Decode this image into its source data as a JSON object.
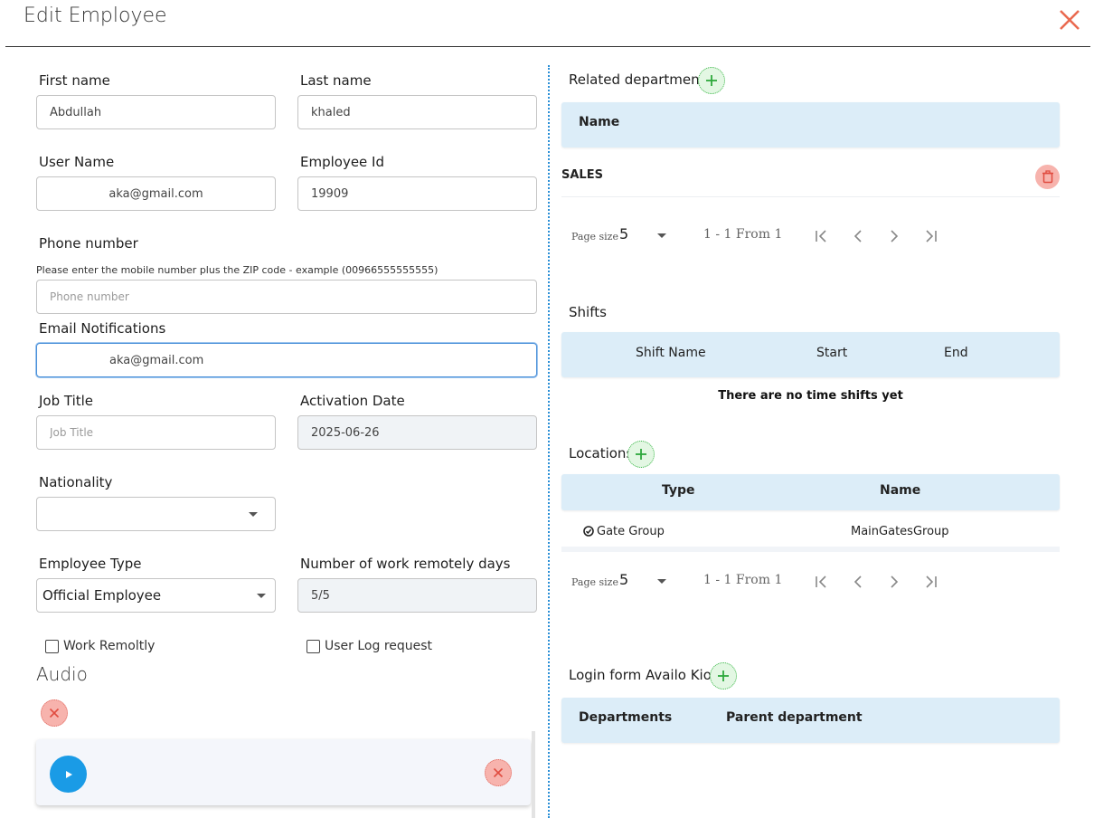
{
  "header": {
    "title": "Edit Employee"
  },
  "form": {
    "first_name": {
      "label": "First name",
      "value": "Abdullah"
    },
    "last_name": {
      "label": "Last name",
      "value": "khaled"
    },
    "user_name": {
      "label": "User Name",
      "value": "aka@gmail.com"
    },
    "employee_id": {
      "label": "Employee Id",
      "value": "19909"
    },
    "phone": {
      "label": "Phone number",
      "hint": "Please enter the mobile number plus the ZIP code - example (00966555555555)",
      "placeholder": "Phone number",
      "value": ""
    },
    "email_notifications": {
      "label": "Email Notifications",
      "value": "aka@gmail.com"
    },
    "job_title": {
      "label": "Job Title",
      "placeholder": "Job Title",
      "value": ""
    },
    "activation_date": {
      "label": "Activation Date",
      "value": "2025-06-26"
    },
    "nationality": {
      "label": "Nationality",
      "value": ""
    },
    "employee_type": {
      "label": "Employee Type",
      "value": "Official Employee"
    },
    "remote_days": {
      "label": "Number of work remotely days",
      "value": "5/5"
    },
    "work_remotely": {
      "label": "Work Remoltly",
      "checked": false
    },
    "user_log_request": {
      "label": "User Log request",
      "checked": false
    }
  },
  "audio": {
    "title": "Audio"
  },
  "related_departments": {
    "title": "Related departments",
    "columns": [
      "Name"
    ],
    "rows": [
      {
        "name": "SALES"
      }
    ],
    "pager": {
      "page_size_label": "Page size",
      "page_size": "5",
      "range": "1 - 1 From 1"
    }
  },
  "shifts": {
    "title": "Shifts",
    "columns": [
      "Shift Name",
      "Start",
      "End"
    ],
    "empty_message": "There are no time shifts yet"
  },
  "locations": {
    "title": "Locations",
    "columns": [
      "Type",
      "Name"
    ],
    "rows": [
      {
        "type": "Gate Group",
        "name": "MainGatesGroup"
      }
    ],
    "pager": {
      "page_size_label": "Page size",
      "page_size": "5",
      "range": "1 - 1 From 1"
    }
  },
  "kiosk": {
    "title": "Login form Availo Kiosk",
    "columns": [
      "Departments",
      "Parent department"
    ]
  },
  "colors": {
    "accent": "#1a9be6",
    "header_bg": "#dcedf8",
    "danger": "#e06a60",
    "add": "#3cb84a",
    "divider": "#2b8fd6"
  }
}
